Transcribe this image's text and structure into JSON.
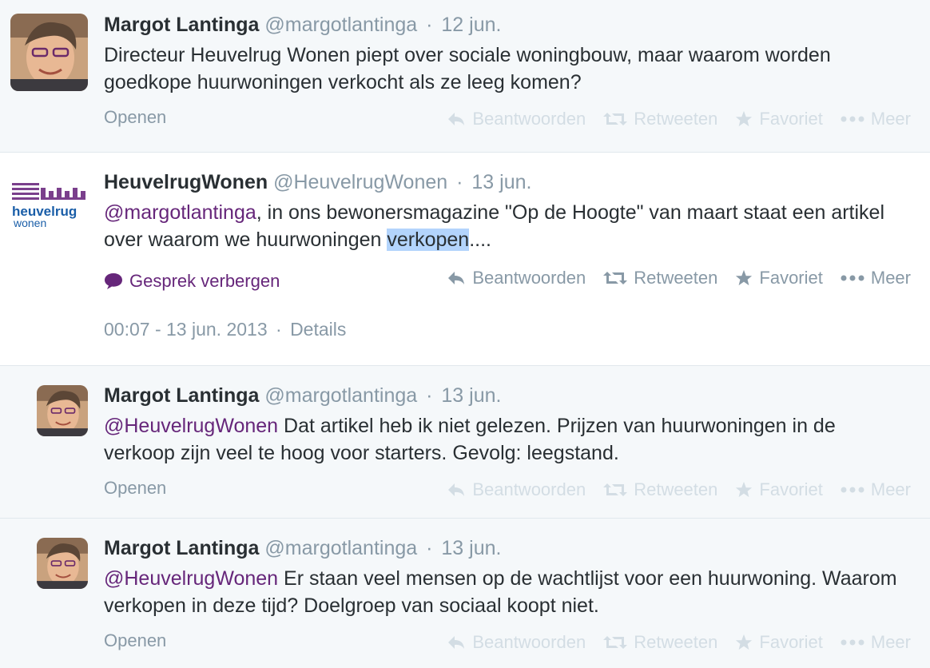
{
  "tweets": [
    {
      "name": "Margot Lantinga",
      "handle": "@margotlantinga",
      "sep": "·",
      "time": "12 jun.",
      "text": "Directeur Heuvelrug Wonen piept over sociale woningbouw, maar waarom worden goedkope huurwoningen verkocht als ze leeg komen?",
      "open": "Openen"
    },
    {
      "name": "HeuvelrugWonen",
      "handle": "@HeuvelrugWonen",
      "sep": "·",
      "time": "13 jun.",
      "mention": "@margotlantinga",
      "text_a": ", in ons bewonersmagazine \"Op de Hoogte\" van maart staat een artikel over waarom we huurwoningen ",
      "text_hl": "verkopen",
      "text_b": "....",
      "convo": "Gesprek verbergen",
      "logo_line1": "heuvelrug",
      "logo_line2": "wonen",
      "timestamp": "00:07 - 13 jun. 2013",
      "details": "Details"
    },
    {
      "name": "Margot Lantinga",
      "handle": "@margotlantinga",
      "sep": "·",
      "time": "13 jun.",
      "mention": "@HeuvelrugWonen",
      "text": " Dat artikel heb ik niet gelezen. Prijzen van huurwoningen in de verkoop zijn veel te hoog voor starters. Gevolg: leegstand.",
      "open": "Openen"
    },
    {
      "name": "Margot Lantinga",
      "handle": "@margotlantinga",
      "sep": "·",
      "time": "13 jun.",
      "mention": "@HeuvelrugWonen",
      "text": " Er staan veel mensen op de wachtlijst voor een huurwoning. Waarom verkopen in deze tijd? Doelgroep van sociaal koopt niet.",
      "open": "Openen"
    }
  ],
  "actions": {
    "reply": "Beantwoorden",
    "retweet": "Retweeten",
    "favorite": "Favoriet",
    "more": "Meer"
  },
  "icons": [
    "reply-icon",
    "retweet-icon",
    "star-icon",
    "more-icon",
    "conversation-icon"
  ],
  "colors": {
    "link_purple": "#66267a",
    "muted": "#8899a6",
    "faded": "#d3dde4",
    "highlight": "#b3d4fc"
  }
}
